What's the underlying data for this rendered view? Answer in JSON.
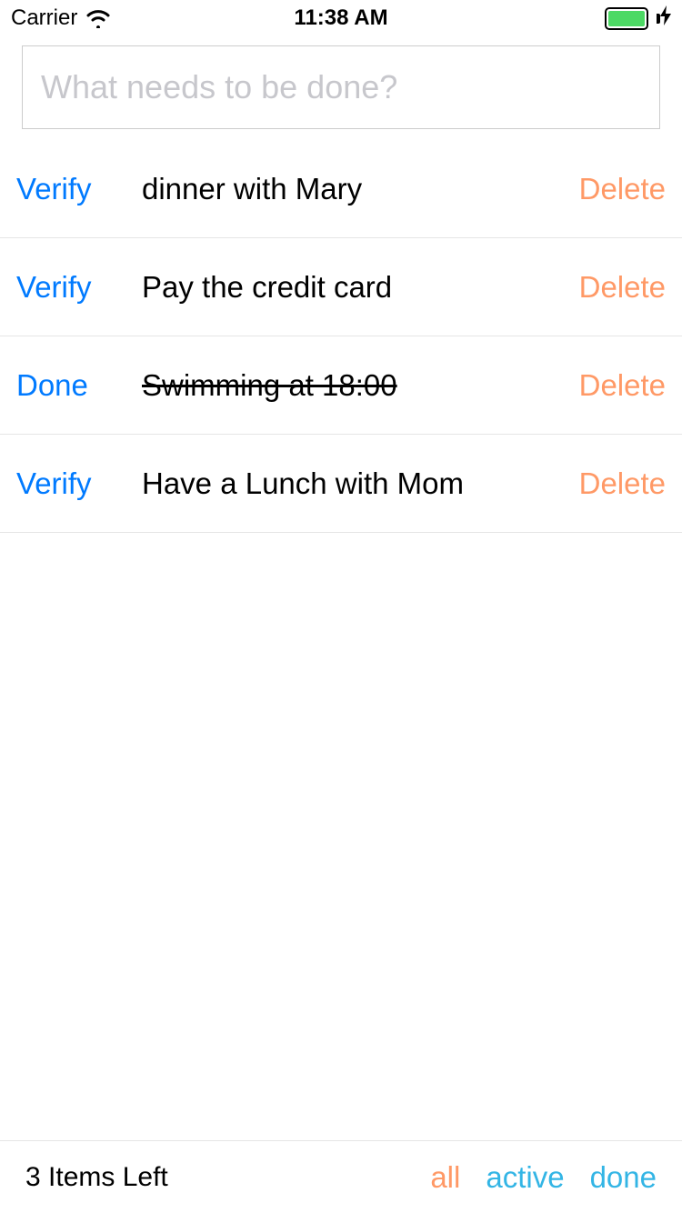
{
  "statusBar": {
    "carrier": "Carrier",
    "time": "11:38 AM"
  },
  "input": {
    "placeholder": "What needs to be done?",
    "value": ""
  },
  "labels": {
    "verify": "Verify",
    "done": "Done",
    "delete": "Delete"
  },
  "todos": [
    {
      "status": "verify",
      "text": "dinner with Mary",
      "completed": false
    },
    {
      "status": "verify",
      "text": "Pay the credit card",
      "completed": false
    },
    {
      "status": "done",
      "text": "Swimming at 18:00",
      "completed": true
    },
    {
      "status": "verify",
      "text": "Have a Lunch with Mom",
      "completed": false
    }
  ],
  "footer": {
    "itemsLeft": "3 Items Left",
    "filters": {
      "all": "all",
      "active": "active",
      "done": "done"
    }
  }
}
